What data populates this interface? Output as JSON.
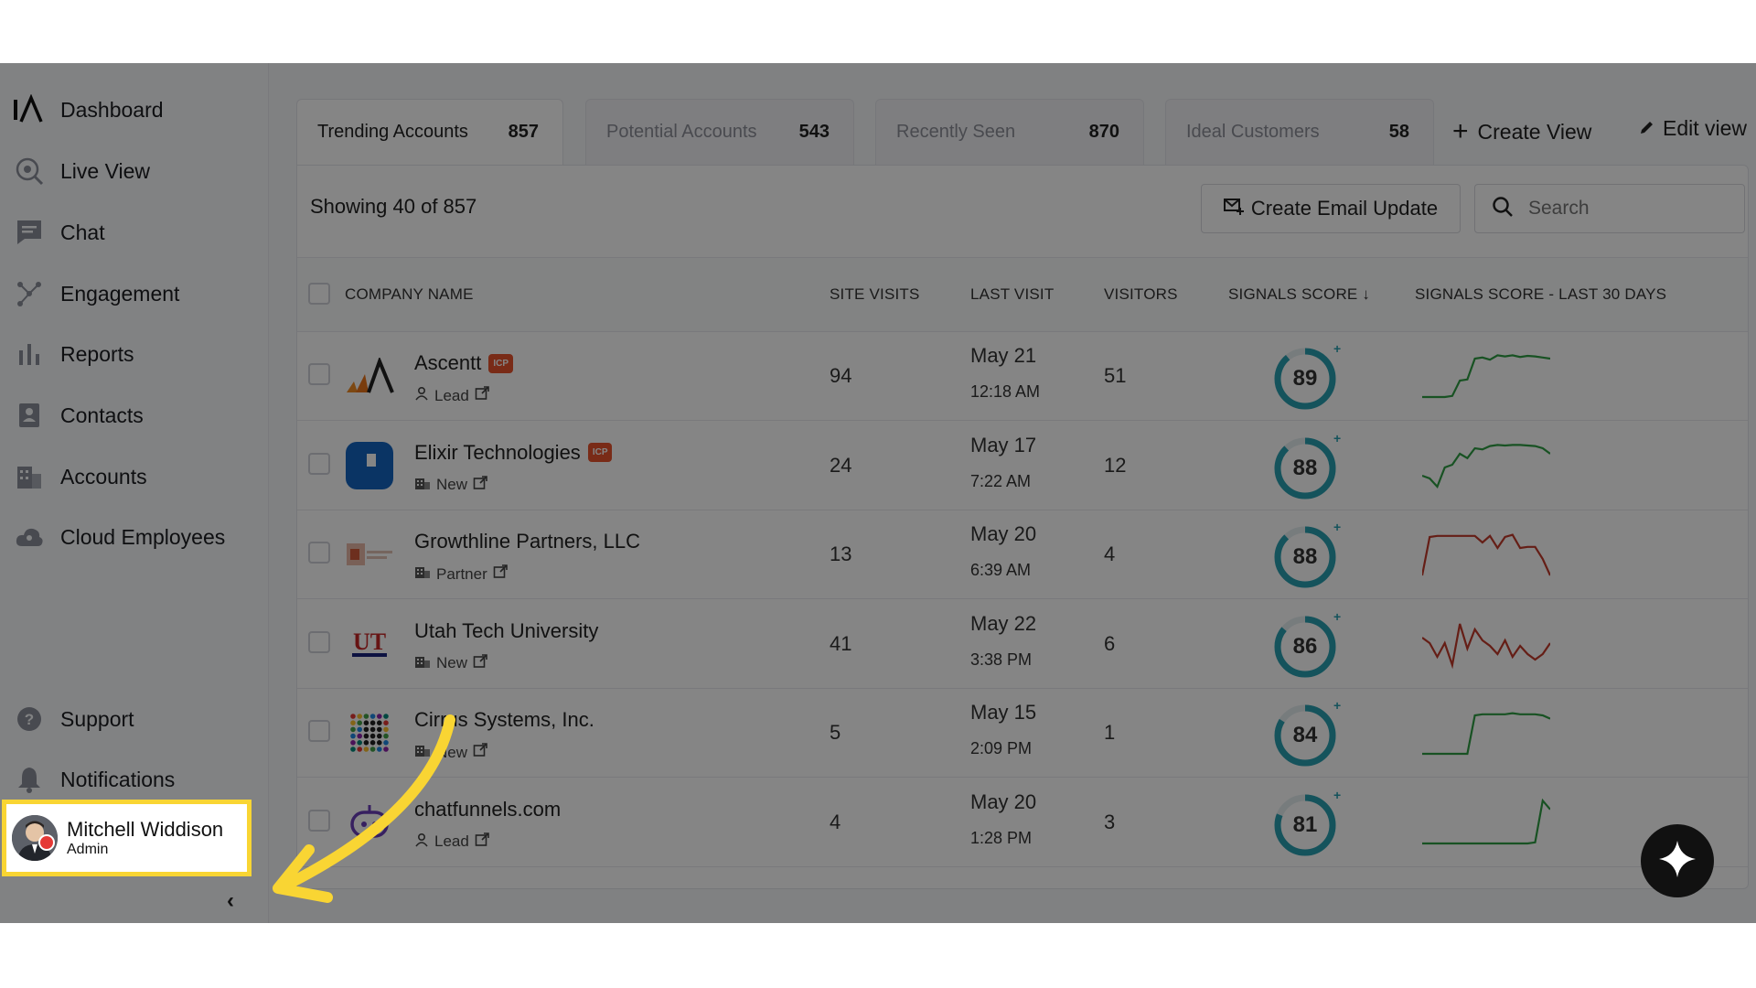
{
  "sidebar": {
    "items": [
      {
        "label": "Dashboard",
        "icon": "logo-icon"
      },
      {
        "label": "Live View",
        "icon": "live-view-icon"
      },
      {
        "label": "Chat",
        "icon": "chat-icon"
      },
      {
        "label": "Engagement",
        "icon": "engagement-icon"
      },
      {
        "label": "Reports",
        "icon": "bar-chart-icon"
      },
      {
        "label": "Contacts",
        "icon": "contacts-icon"
      },
      {
        "label": "Accounts",
        "icon": "building-icon"
      },
      {
        "label": "Cloud Employees",
        "icon": "cloud-icon"
      }
    ],
    "bottom": [
      {
        "label": "Support",
        "icon": "help-icon"
      },
      {
        "label": "Notifications",
        "icon": "bell-icon"
      }
    ],
    "user": {
      "name": "Mitchell Widdison",
      "role": "Admin",
      "status_color": "#e53935"
    },
    "collapse_label": "‹"
  },
  "tabs": [
    {
      "label": "Trending Accounts",
      "count": "857"
    },
    {
      "label": "Potential Accounts",
      "count": "543"
    },
    {
      "label": "Recently Seen",
      "count": "870"
    },
    {
      "label": "Ideal Customers",
      "count": "58"
    }
  ],
  "actions": {
    "create_view": "Create View",
    "edit_view": "Edit view"
  },
  "toolbar": {
    "showing": "Showing 40 of  857",
    "email_button": "Create Email Update",
    "search_placeholder": "Search"
  },
  "table": {
    "columns": {
      "company": "COMPANY NAME",
      "site_visits": "SITE VISITS",
      "last_visit": "LAST VISIT",
      "visitors": "VISITORS",
      "signals_score": "SIGNALS SCORE",
      "signals_30": "SIGNALS SCORE - LAST 30 DAYS"
    },
    "rows": [
      {
        "name": "Ascentt",
        "icp": "ICP",
        "type": "Lead",
        "type_icon": "person-icon",
        "site_visits": "94",
        "date": "May 21",
        "time": "12:18 AM",
        "visitors": "51",
        "score": "89",
        "score_value": 89,
        "trend": [
          10,
          10,
          10,
          10,
          12,
          40,
          42,
          80,
          82,
          78,
          86,
          84,
          86,
          83,
          85,
          84,
          82,
          80
        ],
        "trend_color": "#2e9e43"
      },
      {
        "name": "Elixir Technologies",
        "icp": "ICP",
        "type": "New",
        "type_icon": "building-icon",
        "site_visits": "24",
        "date": "May 17",
        "time": "7:22 AM",
        "visitors": "12",
        "score": "88",
        "score_value": 88,
        "trend": [
          30,
          25,
          10,
          45,
          50,
          70,
          62,
          80,
          78,
          84,
          86,
          85,
          86,
          86,
          85,
          84,
          80,
          70
        ],
        "trend_color": "#2e9e43"
      },
      {
        "name": "Growthline Partners, LLC",
        "icp": "",
        "type": "Partner",
        "type_icon": "building-icon",
        "site_visits": "13",
        "date": "May 20",
        "time": "6:39 AM",
        "visitors": "4",
        "score": "88",
        "score_value": 88,
        "trend": [
          10,
          80,
          82,
          82,
          82,
          82,
          82,
          82,
          70,
          82,
          60,
          80,
          84,
          60,
          62,
          62,
          40,
          10
        ],
        "trend_color": "#c23a2b"
      },
      {
        "name": "Utah Tech University",
        "icp": "",
        "type": "New",
        "type_icon": "building-icon",
        "site_visits": "41",
        "date": "May 22",
        "time": "3:38 PM",
        "visitors": "6",
        "score": "86",
        "score_value": 86,
        "trend": [
          60,
          50,
          25,
          50,
          10,
          85,
          40,
          75,
          55,
          45,
          30,
          55,
          25,
          45,
          30,
          20,
          30,
          50
        ],
        "trend_color": "#c23a2b"
      },
      {
        "name": "Cirrus Systems, Inc.",
        "icp": "",
        "type": "New",
        "type_icon": "building-icon",
        "site_visits": "5",
        "date": "May 15",
        "time": "2:09 PM",
        "visitors": "1",
        "score": "84",
        "score_value": 84,
        "trend": [
          10,
          10,
          10,
          10,
          10,
          10,
          10,
          80,
          82,
          82,
          82,
          82,
          84,
          82,
          82,
          82,
          80,
          74
        ],
        "trend_color": "#2e9e43"
      },
      {
        "name": "chatfunnels.com",
        "icp": "",
        "type": "Lead",
        "type_icon": "person-icon",
        "site_visits": "4",
        "date": "May 20",
        "time": "1:28 PM",
        "visitors": "3",
        "score": "81",
        "score_value": 81,
        "trend": [
          10,
          10,
          10,
          10,
          10,
          10,
          10,
          10,
          10,
          10,
          10,
          10,
          10,
          10,
          10,
          12,
          88,
          72
        ],
        "trend_color": "#2e9e43"
      }
    ]
  },
  "colors": {
    "accent": "#2a9fb0",
    "icp_badge": "#e8542c",
    "highlight": "#f9d533"
  }
}
